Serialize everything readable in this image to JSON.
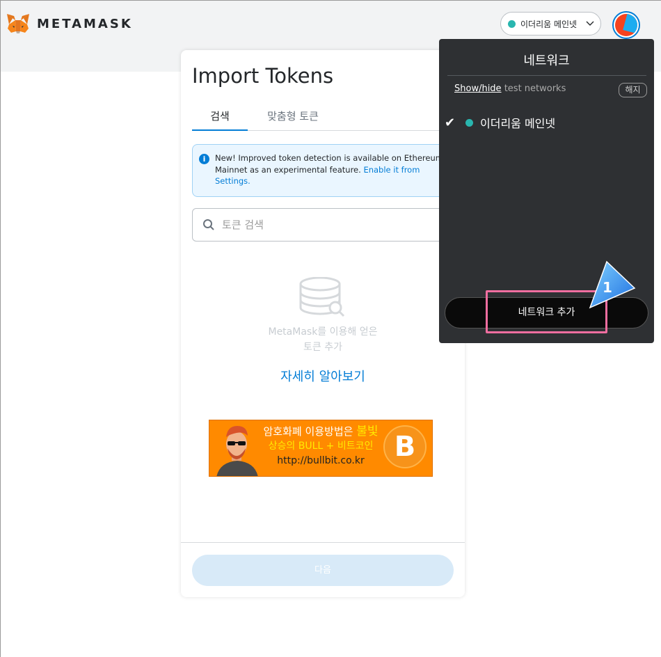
{
  "header": {
    "logo_text": "METAMASK",
    "network_label": "이더리움 메인넷"
  },
  "modal": {
    "title": "Import Tokens",
    "tabs": [
      {
        "label": "검색",
        "active": true
      },
      {
        "label": "맞춤형 토큰",
        "active": false
      }
    ],
    "notice": {
      "text": "New! Improved token detection is available on Ethereum Mainnet as an experimental feature. ",
      "link": "Enable it from Settings."
    },
    "search_placeholder": "토큰 검색",
    "empty_line1": "MetaMask를 이용해 얻은",
    "empty_line2": "토큰 추가",
    "learn_more": "자세히 알아보기",
    "banner": {
      "line1_prefix": "암호화폐 이용방법은 ",
      "line1_accent": "불빛",
      "line2": "상승의 BULL + 비트코인",
      "line3": "http://bullbit.co.kr",
      "coin_symbol": "B"
    },
    "next_label": "다음"
  },
  "network_dropdown": {
    "title": "네트워크",
    "show_hide": "Show/hide",
    "test_networks": " test networks",
    "hide_button": "해지",
    "networks": [
      {
        "label": "이더리움 메인넷",
        "selected": true,
        "color": "#29b6af"
      }
    ],
    "add_network": "네트워크 추가"
  },
  "annotation": {
    "step_number": "1",
    "highlight_color": "#f06ea0",
    "pointer_color": "#2a8cff"
  }
}
